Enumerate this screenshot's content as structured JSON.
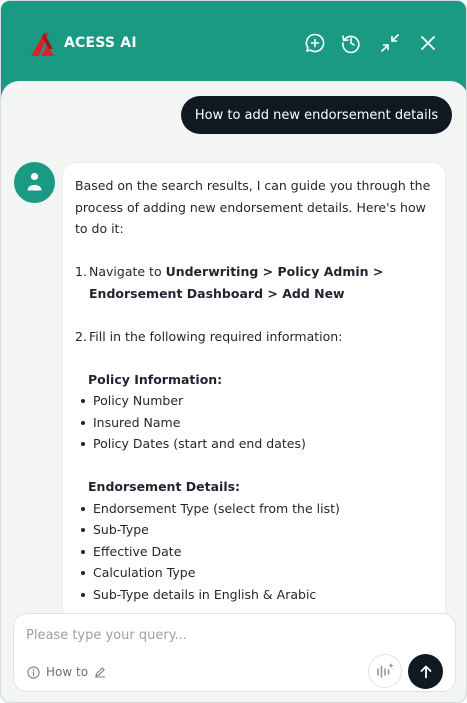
{
  "header": {
    "brand": "ACESS AI",
    "icons": [
      "new-chat-icon",
      "history-icon",
      "minimize-icon",
      "close-icon"
    ]
  },
  "colors": {
    "header_bg": "#1a9a82",
    "content_bg": "#f3f4f4",
    "user_bubble": "#101922",
    "logo_red": "#d8232a"
  },
  "user_message": "How to add new endorsement details",
  "bot_message": {
    "intro": "Based on the search results, I can guide you through the process of adding new endorsement details. Here's how to do it:",
    "step1": {
      "number": "1.",
      "prefix": "Navigate to ",
      "path": "Underwriting > Policy Admin > Endorsement Dashboard > Add New"
    },
    "step2": {
      "number": "2.",
      "text": "Fill in the following required information:"
    },
    "sections": [
      {
        "title": "Policy Information:",
        "items": [
          "Policy Number",
          "Insured Name",
          "Policy Dates (start and end dates)"
        ]
      },
      {
        "title": "Endorsement Details:",
        "items": [
          "Endorsement Type (select from the list)",
          "Sub-Type",
          "Effective Date",
          "Calculation Type",
          "Sub-Type details in English & Arabic"
        ]
      }
    ]
  },
  "composer": {
    "placeholder": "Please type your query...",
    "value": "",
    "howto_label": "How to"
  }
}
